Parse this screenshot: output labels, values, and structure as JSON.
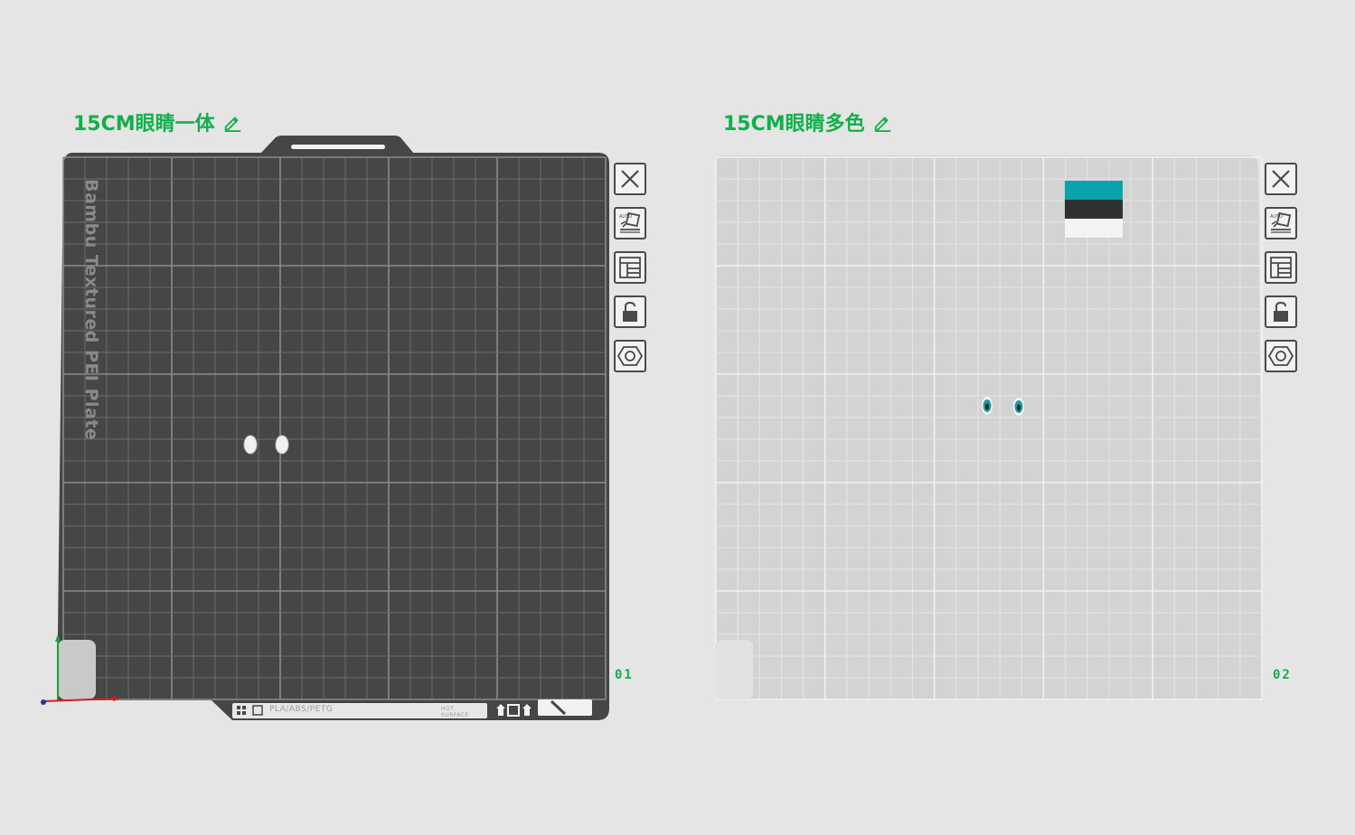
{
  "plates": [
    {
      "title": "15CM眼睛一体",
      "number": "01",
      "bed_brand": "Bambu Textured PEI Plate",
      "bed_material": "PLA/ABS/PETG",
      "bed_warning": "HOT SURFACE",
      "mode": "editing"
    },
    {
      "title": "15CM眼睛多色",
      "number": "02",
      "mode": "preview",
      "filament_colors": [
        "#0aa3ad",
        "#2f3030",
        "#f4f4f4"
      ]
    }
  ],
  "toolbar": {
    "buttons": [
      {
        "name": "remove-plate",
        "icon": "close-icon"
      },
      {
        "name": "auto-orient",
        "icon": "auto-orient-icon"
      },
      {
        "name": "arrange",
        "icon": "arrange-icon"
      },
      {
        "name": "lock",
        "icon": "unlock-icon"
      },
      {
        "name": "plate-settings",
        "icon": "hex-settings-icon"
      }
    ]
  },
  "colors": {
    "accent": "#12b04a",
    "bed_dark": "#454747",
    "bed_light": "#d4d4d4",
    "eye_teal": "#1b9aa6"
  }
}
